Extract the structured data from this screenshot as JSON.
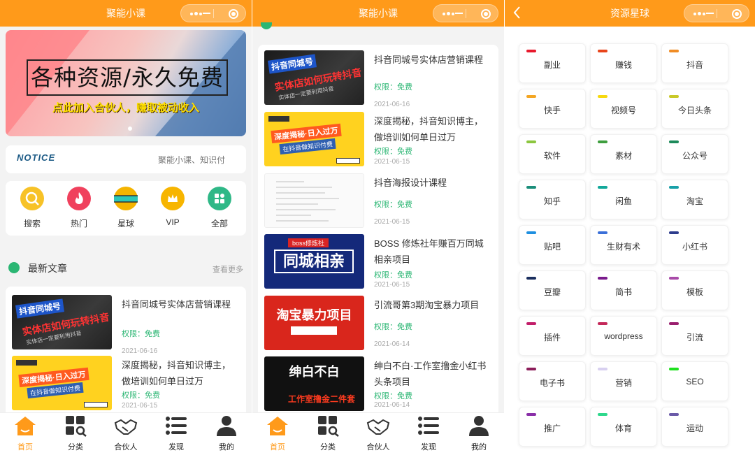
{
  "app_title": "聚能小课",
  "phone3_title": "资源星球",
  "banner": {
    "headline": "各种资源/永久免费",
    "subline": "点此加入合伙人，赚取被动收入"
  },
  "notice": {
    "logo": "NOTICE",
    "text": "聚能小课、知识付"
  },
  "quick_icons": [
    {
      "label": "搜索",
      "icon": "search-icon",
      "color": "#f7c227"
    },
    {
      "label": "热门",
      "icon": "flame-icon",
      "color": "#f0415d"
    },
    {
      "label": "星球",
      "icon": "planet-icon",
      "color": "#f5b400"
    },
    {
      "label": "VIP",
      "icon": "crown-icon",
      "color": "#f7b500"
    },
    {
      "label": "全部",
      "icon": "grid-icon",
      "color": "#2fb887"
    }
  ],
  "section": {
    "title": "最新文章",
    "more": "查看更多"
  },
  "articles": [
    {
      "title": "抖音同城号实体店营销课程",
      "free": "权限：免费",
      "date": "2021-06-16"
    },
    {
      "title": "深度揭秘，抖音知识博主，做培训如何单日过万",
      "free": "权限：免费",
      "date": "2021-06-15"
    },
    {
      "title": "抖音海报设计课程",
      "free": "权限：免费",
      "date": "2021-06-15"
    },
    {
      "title": "BOSS 修炼社年赚百万同城相亲项目",
      "free": "权限：免费",
      "date": "2021-06-15"
    },
    {
      "title": "引流哥第3期淘宝暴力项目",
      "free": "权限：免费",
      "date": "2021-06-14"
    },
    {
      "title": "绅白不白·工作室撸金小红书头条项目",
      "free": "权限：免费",
      "date": "2021-06-14"
    }
  ],
  "thumb_text": {
    "dy_tag": "抖音同城号",
    "dy_main": "实体店如何玩转抖音",
    "dy_small": "实体店一定要利用抖音",
    "yellow_main": "深度揭秘·日入过万",
    "yellow_sub": "在抖音做知识付费",
    "boss_tag": "boss修炼社",
    "boss_main": "同城相亲",
    "taobao_main": "淘宝暴力项目",
    "black_main": "绅白不白",
    "black_sub": "工作室撸金二件套"
  },
  "tabbar": [
    {
      "label": "首页",
      "icon": "home-icon",
      "active": true
    },
    {
      "label": "分类",
      "icon": "category-icon",
      "active": false
    },
    {
      "label": "合伙人",
      "icon": "handshake-icon",
      "active": false
    },
    {
      "label": "发现",
      "icon": "list-icon",
      "active": false
    },
    {
      "label": "我的",
      "icon": "user-icon",
      "active": false
    }
  ],
  "planet_tiles": [
    {
      "label": "副业",
      "color": "#e8192c"
    },
    {
      "label": "赚钱",
      "color": "#e8441a"
    },
    {
      "label": "抖音",
      "color": "#f08c24"
    },
    {
      "label": "快手",
      "color": "#f4a623"
    },
    {
      "label": "视频号",
      "color": "#f7d90f"
    },
    {
      "label": "今日头条",
      "color": "#c9c928"
    },
    {
      "label": "软件",
      "color": "#8cc63f"
    },
    {
      "label": "素材",
      "color": "#3e9e3e"
    },
    {
      "label": "公众号",
      "color": "#1d8a5a"
    },
    {
      "label": "知乎",
      "color": "#1b8e7a"
    },
    {
      "label": "闲鱼",
      "color": "#12a89a"
    },
    {
      "label": "淘宝",
      "color": "#18a0a8"
    },
    {
      "label": "贴吧",
      "color": "#1e8fe0"
    },
    {
      "label": "生财有术",
      "color": "#3a6fd8"
    },
    {
      "label": "小红书",
      "color": "#2d3c8c"
    },
    {
      "label": "豆瓣",
      "color": "#1b2f5e"
    },
    {
      "label": "简书",
      "color": "#7a1b8c"
    },
    {
      "label": "模板",
      "color": "#a84aa8"
    },
    {
      "label": "插件",
      "color": "#c21e6a"
    },
    {
      "label": "wordpress",
      "color": "#c4285a"
    },
    {
      "label": "引流",
      "color": "#9a1e6e"
    },
    {
      "label": "电子书",
      "color": "#8c1e5a"
    },
    {
      "label": "营销",
      "color": "#d8d0f0"
    },
    {
      "label": "SEO",
      "color": "#1ee01e"
    },
    {
      "label": "推广",
      "color": "#8a2fa8"
    },
    {
      "label": "体育",
      "color": "#2ed88c"
    },
    {
      "label": "运动",
      "color": "#6a5aa8"
    }
  ]
}
